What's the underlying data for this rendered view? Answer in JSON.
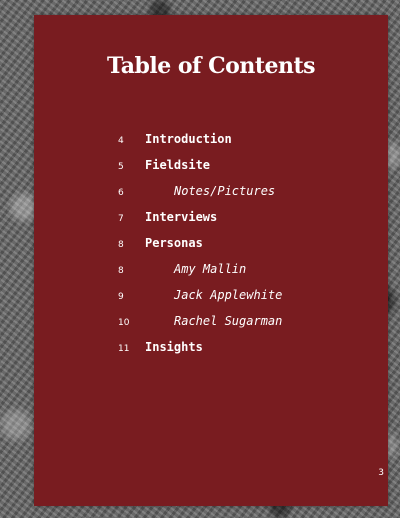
{
  "title": "Table of Contents",
  "toc": [
    {
      "page": "4",
      "label": "Introduction",
      "sub": false
    },
    {
      "page": "5",
      "label": "Fieldsite",
      "sub": false
    },
    {
      "page": "6",
      "label": "Notes/Pictures",
      "sub": true
    },
    {
      "page": "7",
      "label": "Interviews",
      "sub": false
    },
    {
      "page": "8",
      "label": "Personas",
      "sub": false
    },
    {
      "page": "8",
      "label": "Amy Mallin",
      "sub": true
    },
    {
      "page": "9",
      "label": "Jack Applewhite",
      "sub": true
    },
    {
      "page": "10",
      "label": "Rachel Sugarman",
      "sub": true
    },
    {
      "page": "11",
      "label": "Insights",
      "sub": false
    }
  ],
  "page_number": "3",
  "colors": {
    "page_background": "#791c20",
    "text": "#ffffff"
  }
}
